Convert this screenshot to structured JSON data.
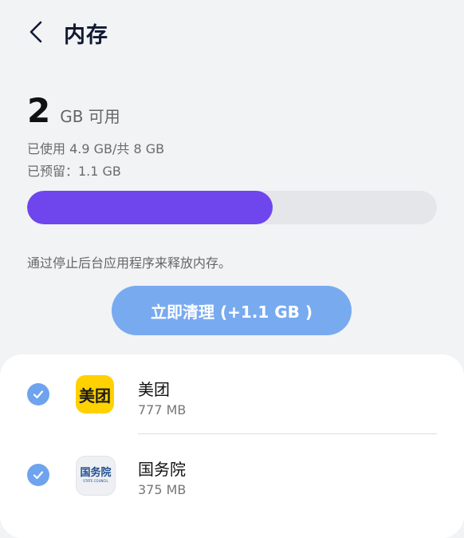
{
  "header": {
    "title": "内存"
  },
  "memory": {
    "available_value": "2",
    "available_unit": "GB 可用",
    "used_text": "已使用 4.9 GB/共 8 GB",
    "reserved_text": "已预留：1.1 GB",
    "used_fraction": 0.6
  },
  "hint": "通过停止后台应用程序来释放内存。",
  "clean_button": {
    "label": "立即清理 (+1.1 GB )"
  },
  "apps": [
    {
      "name": "美团",
      "size": "777 MB",
      "icon_text": "美团",
      "checked": true
    },
    {
      "name": "国务院",
      "size": "375 MB",
      "icon_text": "国务院",
      "icon_subtext": "STATE COUNCIL",
      "checked": true
    }
  ],
  "colors": {
    "bar_fill": "#6f45ee",
    "button": "#78aaf0",
    "check": "#6ea3ee",
    "meituan_yellow": "#ffd100"
  }
}
